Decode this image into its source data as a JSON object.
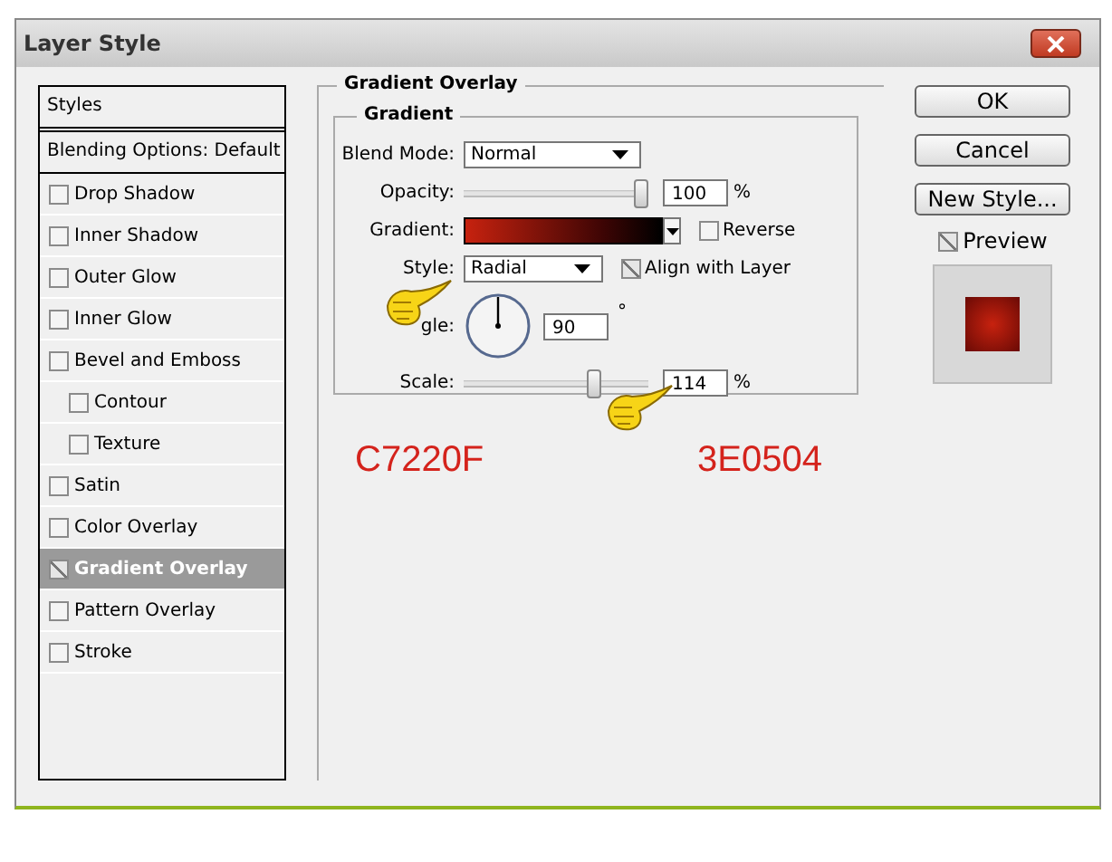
{
  "window": {
    "title": "Layer Style"
  },
  "styles_list": {
    "header": "Styles",
    "blending": "Blending Options: Default",
    "items": [
      {
        "label": "Drop Shadow",
        "checked": false,
        "selected": false
      },
      {
        "label": "Inner Shadow",
        "checked": false,
        "selected": false
      },
      {
        "label": "Outer Glow",
        "checked": false,
        "selected": false
      },
      {
        "label": "Inner Glow",
        "checked": false,
        "selected": false
      },
      {
        "label": "Bevel and Emboss",
        "checked": false,
        "selected": false,
        "children": [
          {
            "label": "Contour",
            "checked": false,
            "selected": false
          },
          {
            "label": "Texture",
            "checked": false,
            "selected": false
          }
        ]
      },
      {
        "label": "Satin",
        "checked": false,
        "selected": false
      },
      {
        "label": "Color Overlay",
        "checked": false,
        "selected": false
      },
      {
        "label": "Gradient Overlay",
        "checked": true,
        "selected": true
      },
      {
        "label": "Pattern Overlay",
        "checked": false,
        "selected": false
      },
      {
        "label": "Stroke",
        "checked": false,
        "selected": false
      }
    ]
  },
  "panel": {
    "title": "Gradient Overlay",
    "group": "Gradient",
    "blend_mode": {
      "label": "Blend Mode:",
      "value": "Normal"
    },
    "opacity": {
      "label": "Opacity:",
      "level": 1.0,
      "value": "100",
      "unit": "%"
    },
    "gradient": {
      "label": "Gradient:",
      "reverse": {
        "label": "Reverse",
        "checked": false
      }
    },
    "style": {
      "label": "Style:",
      "value": "Radial",
      "align": {
        "label": "Align with Layer",
        "checked": true
      }
    },
    "angle": {
      "label": "gle:",
      "value": "90",
      "unit": "°"
    },
    "scale": {
      "label": "Scale:",
      "level": 0.72,
      "value": "114",
      "unit": "%"
    },
    "annotations": [
      "C7220F",
      "3E0504"
    ]
  },
  "buttons": [
    "OK",
    "Cancel",
    "New Style..."
  ],
  "preview": {
    "label": "Preview",
    "checked": true
  }
}
